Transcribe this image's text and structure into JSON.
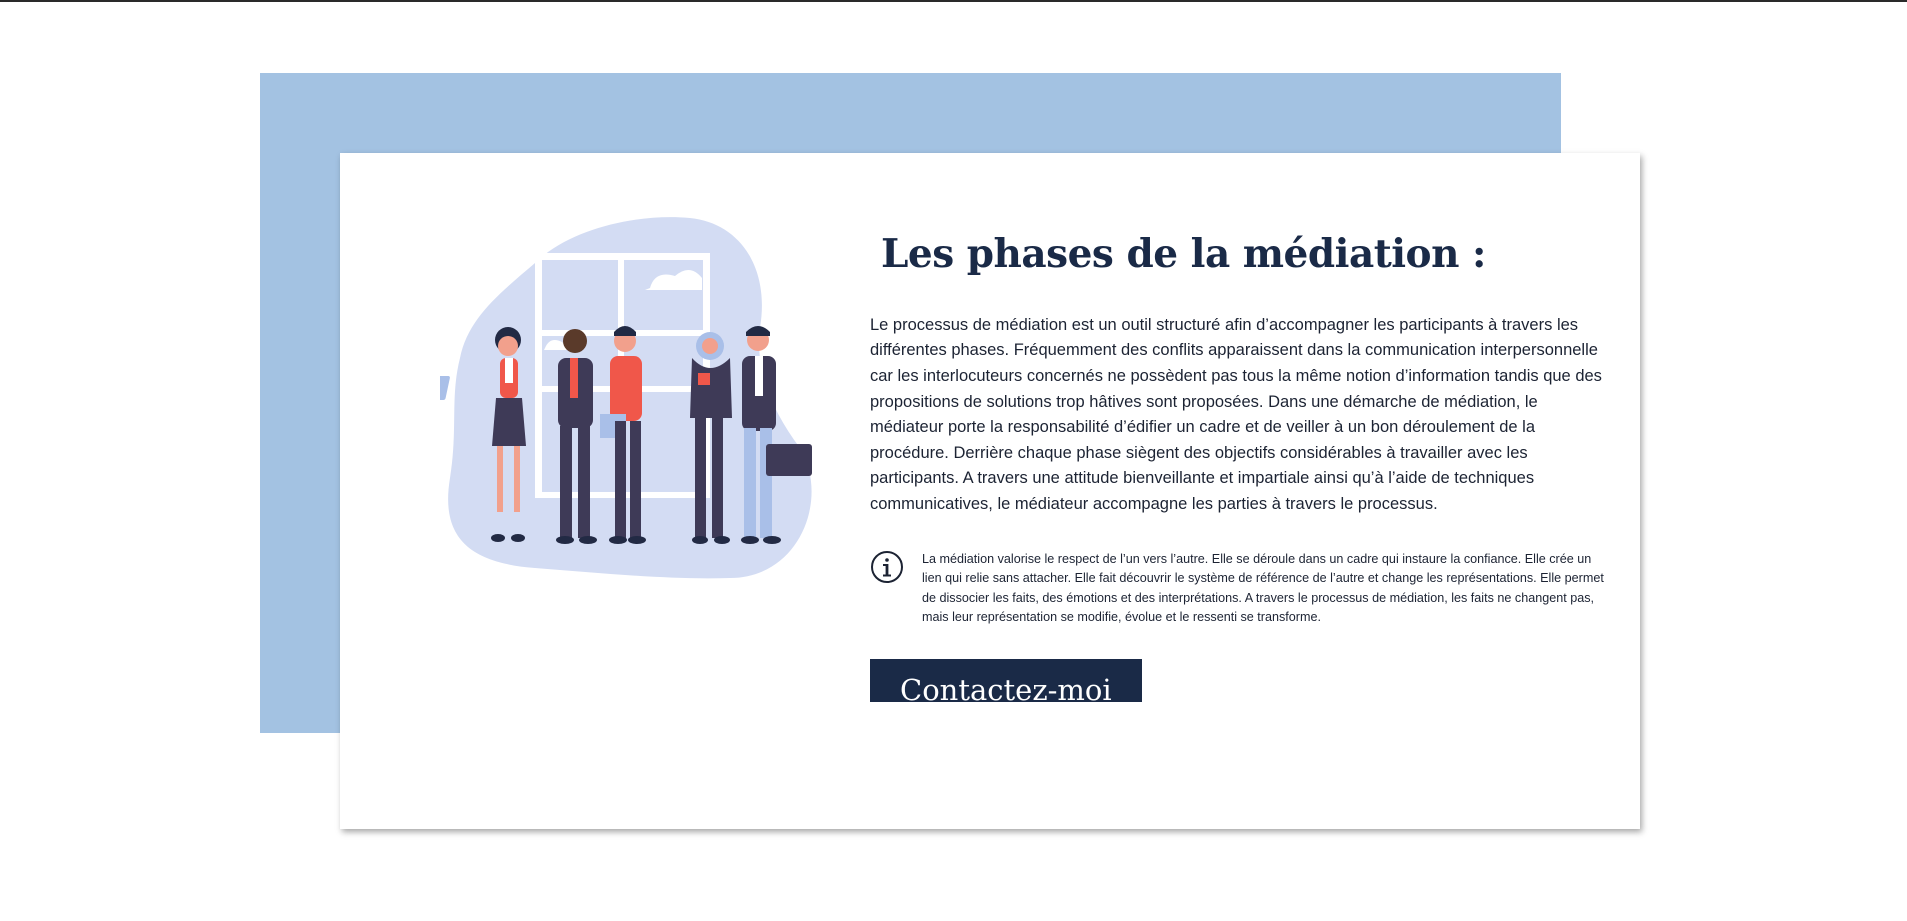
{
  "colors": {
    "accent_blue": "#a3c2e2",
    "navy": "#1a2a47",
    "card_bg": "#ffffff"
  },
  "section": {
    "title": "Les phases de la médiation :",
    "body": "Le processus de médiation est un outil structuré afin d’accompagner les participants à travers les différentes phases. Fréquemment des conflits apparaissent dans la communication interpersonnelle car les interlocuteurs concernés ne possèdent pas tous la même notion d’information tandis que des propositions de solutions trop hâtives sont proposées. Dans une démarche de médiation, le médiateur porte la responsabilité d’édifier un cadre et de veiller à un bon déroulement de la procédure. Derrière chaque phase siègent des objectifs considérables à travailler avec les participants. A travers une attitude bienveillante et impartiale ainsi qu’à l’aide de techniques communicatives, le médiateur accompagne les parties à travers le processus.",
    "note_icon": "info-icon",
    "note": "La médiation valorise le respect de l’un vers l’autre. Elle se déroule dans un cadre qui instaure la confiance. Elle crée un lien qui relie sans attacher. Elle fait découvrir le système de référence de l’autre et change les représentations. Elle permet de dissocier les faits, des émotions et des interprétations. A travers le processus de médiation, les faits ne changent pas, mais leur représentation se modifie, évolue et le ressenti se transforme.",
    "cta_label": "Contactez-moi"
  },
  "illustration": {
    "icon": "business-people-illustration"
  }
}
